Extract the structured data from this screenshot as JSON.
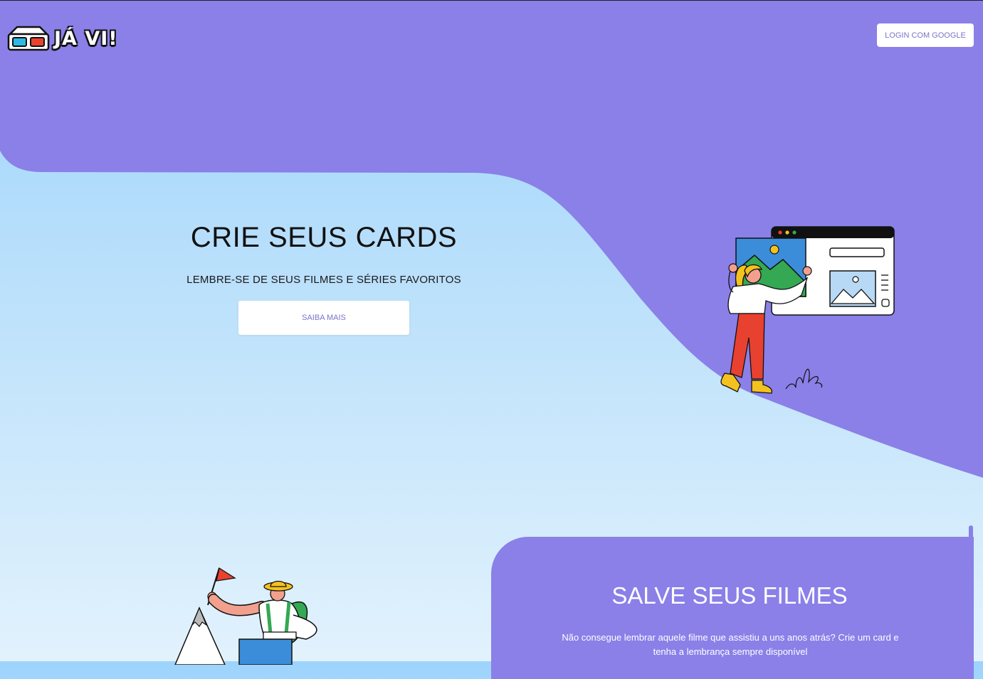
{
  "header": {
    "logo_text": "JÁ VI!",
    "login_label": "LOGIN COM GOOGLE"
  },
  "hero": {
    "title": "CRIE SEUS CARDS",
    "subtitle": "LEMBRE-SE DE SEUS FILMES E SÉRIES FAVORITOS",
    "cta_label": "SAIBA MAIS"
  },
  "feature": {
    "title": "SALVE SEUS FILMES",
    "text": "Não consegue lembrar aquele filme que assistiu a uns anos atrás? Crie um card e tenha a lembrança sempre disponível"
  },
  "colors": {
    "primary_purple": "#8a80e8",
    "sky_light": "#e2f2fd",
    "sky_top": "#9ed4fc"
  },
  "icons": {
    "logo": "3d-glasses-icon"
  }
}
